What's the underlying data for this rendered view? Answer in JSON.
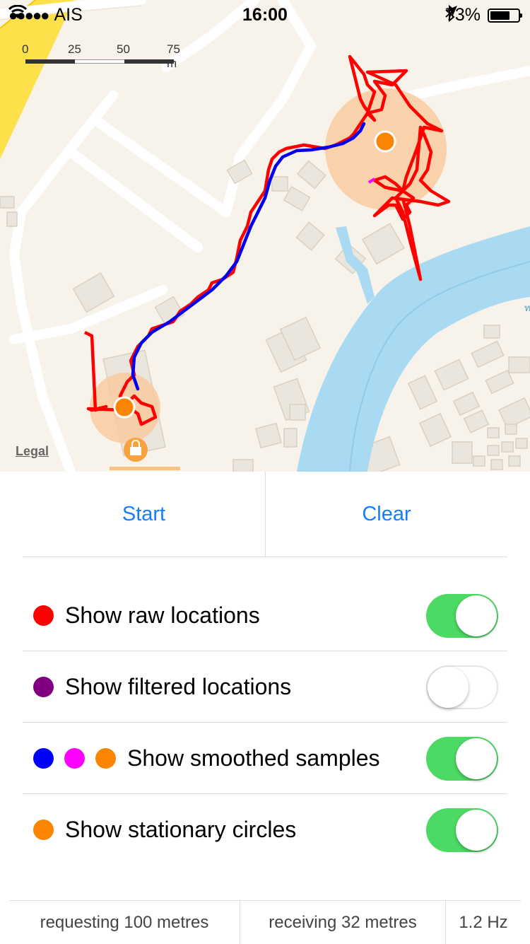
{
  "status_bar": {
    "carrier": "AIS",
    "signal_icon": "signal-dots-icon",
    "wifi_icon": "wifi-icon",
    "time": "16:00",
    "location_icon": "location-arrow-icon",
    "bluetooth_icon": "bluetooth-icon",
    "battery_percent": "73%",
    "battery_level": 0.73
  },
  "map": {
    "scale_labels": [
      "0",
      "25",
      "50",
      "75 m"
    ],
    "legal": "Legal",
    "colors": {
      "land": "#f8f3ea",
      "road": "#ffffff",
      "highway": "#fde14a",
      "water": "#aadaf2",
      "building": "#ebe6dd",
      "raw_track": "#ff0000",
      "smoothed_track": "#0000ee",
      "stationary_circle": "#f9c89b",
      "stationary_dot": "#fb8500"
    },
    "shopping_icon": "shopping-bag-icon"
  },
  "actions": {
    "start_label": "Start",
    "clear_label": "Clear"
  },
  "toggles": [
    {
      "label": "Show raw locations",
      "on": true,
      "dots": [
        "#ff0000"
      ]
    },
    {
      "label": "Show filtered locations",
      "on": false,
      "dots": [
        "#800080"
      ]
    },
    {
      "label": "Show smoothed samples",
      "on": true,
      "dots": [
        "#0000ff",
        "#ff00ff",
        "#fb8500"
      ]
    },
    {
      "label": "Show stationary circles",
      "on": true,
      "dots": [
        "#fb8500"
      ]
    }
  ],
  "footer": {
    "requesting": "requesting 100 metres",
    "receiving": "receiving 32 metres",
    "frequency": "1.2 Hz"
  }
}
